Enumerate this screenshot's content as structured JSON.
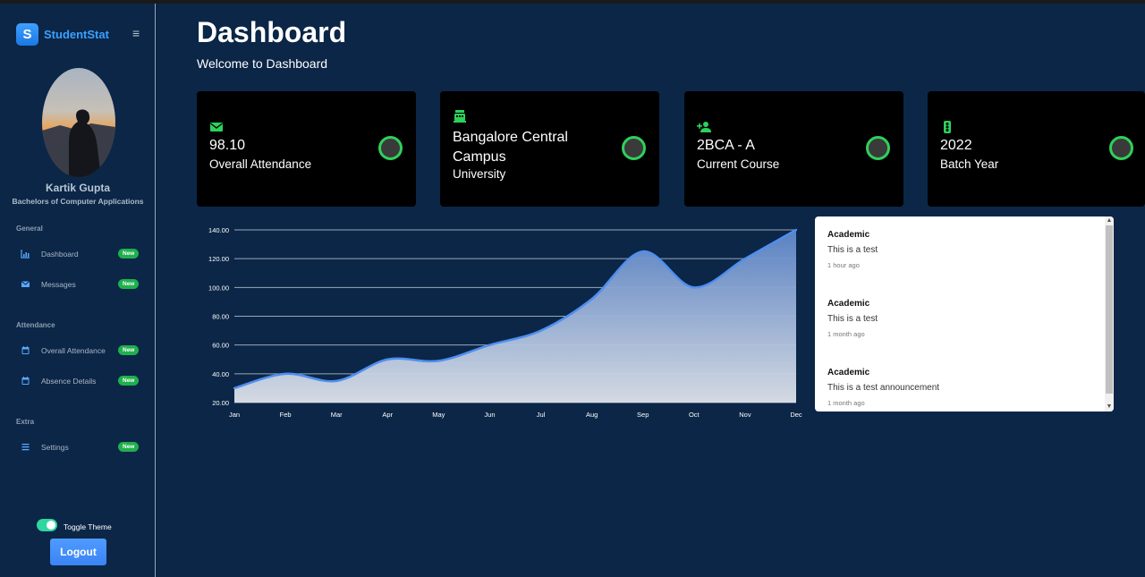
{
  "brand": {
    "logo_letter": "S",
    "name": "StudentStat",
    "menu_icon": "≡"
  },
  "user": {
    "name": "Kartik Gupta",
    "degree": "Bachelors of Computer Applications"
  },
  "sidebar": {
    "sections": [
      {
        "title": "General"
      },
      {
        "title": "Attendance"
      },
      {
        "title": "Extra"
      }
    ],
    "items": [
      {
        "label": "Dashboard",
        "badge": "New",
        "icon": "bar-chart-icon"
      },
      {
        "label": "Messages",
        "badge": "New",
        "icon": "mail-icon"
      },
      {
        "label": "Overall Attendance",
        "badge": "New",
        "icon": "calendar-icon"
      },
      {
        "label": "Absence Details",
        "badge": "New",
        "icon": "calendar-icon"
      },
      {
        "label": "Settings",
        "badge": "New",
        "icon": "list-icon"
      }
    ],
    "toggle_label": "Toggle Theme",
    "toggle_on": true,
    "logout_label": "Logout"
  },
  "header": {
    "title": "Dashboard",
    "subtitle": "Welcome to Dashboard"
  },
  "cards": [
    {
      "value": "98.10",
      "label": "Overall Attendance",
      "icon": "mail-icon"
    },
    {
      "value": "Bangalore Central Campus",
      "label": "University",
      "icon": "university-icon"
    },
    {
      "value": "2BCA - A",
      "label": "Current Course",
      "icon": "person-add-icon"
    },
    {
      "value": "2022",
      "label": "Batch Year",
      "icon": "traffic-light-icon"
    }
  ],
  "colors": {
    "accent_green": "#2ed15a",
    "background": "#0b2647",
    "line": "#4f8fef"
  },
  "chart_data": {
    "type": "area",
    "categories": [
      "Jan",
      "Feb",
      "Mar",
      "Apr",
      "May",
      "Jun",
      "Jul",
      "Aug",
      "Sep",
      "Oct",
      "Nov",
      "Dec"
    ],
    "values": [
      30,
      40,
      35,
      50,
      49,
      60,
      70,
      92,
      125,
      100,
      120,
      140
    ],
    "yticks": [
      "20.00",
      "40.00",
      "60.00",
      "80.00",
      "100.00",
      "120.00",
      "140.00"
    ],
    "ylim": [
      20,
      140
    ],
    "grid": true,
    "title": "",
    "xlabel": "",
    "ylabel": ""
  },
  "announcements": [
    {
      "title": "Academic",
      "text": "This is a test",
      "time": "1 hour ago"
    },
    {
      "title": "Academic",
      "text": "This is a test",
      "time": "1 month ago"
    },
    {
      "title": "Academic",
      "text": "This is a test announcement",
      "time": "1 month ago"
    }
  ]
}
